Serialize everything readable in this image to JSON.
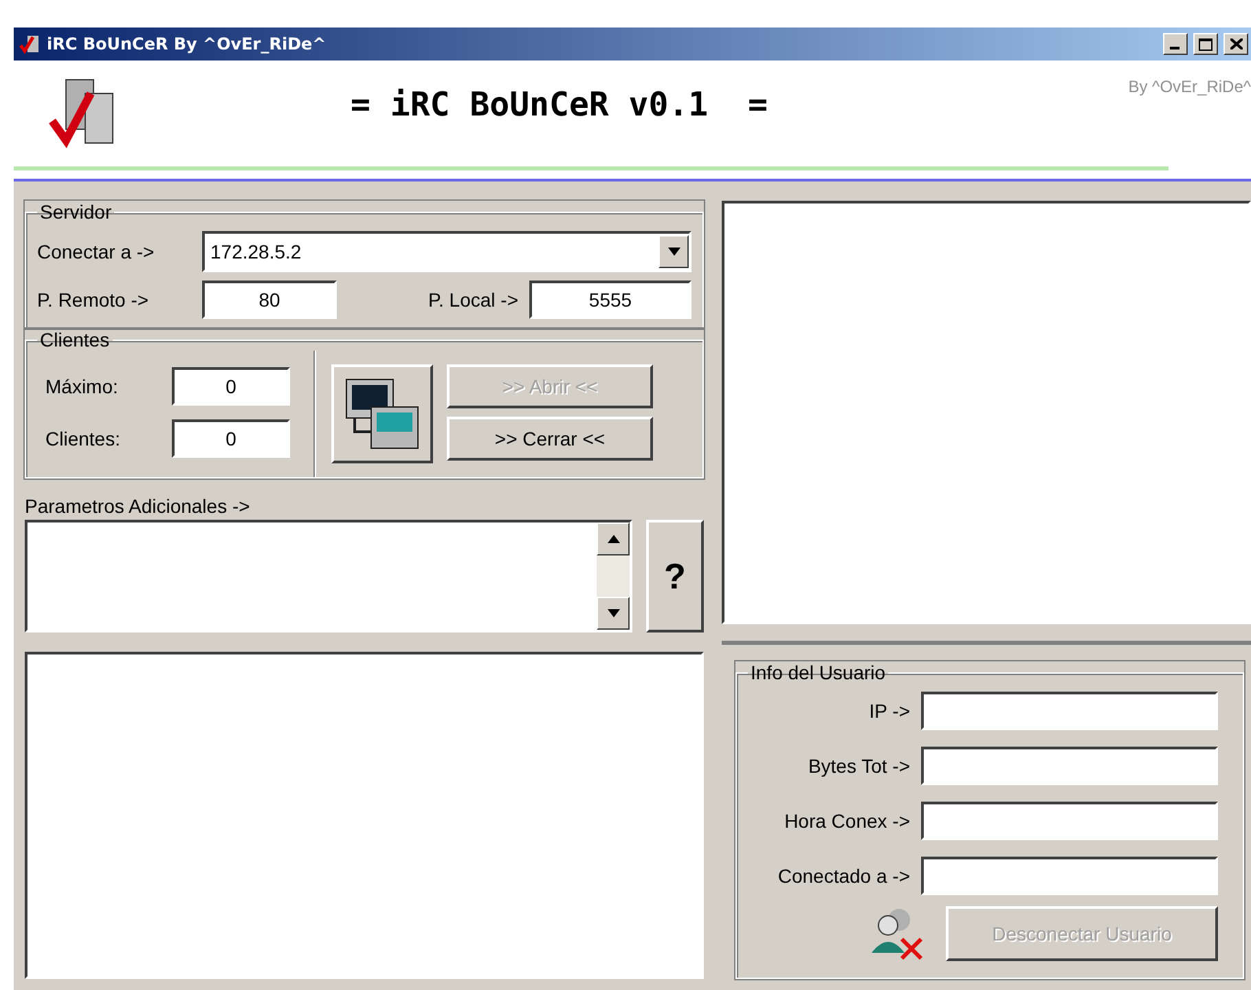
{
  "window": {
    "title": "iRC BoUnCeR By ^OvEr_RiDe^"
  },
  "header": {
    "title": "= iRC BoUnCeR v0.1  =",
    "credit": "By ^OvEr_RiDe^"
  },
  "servidor": {
    "legend": "Servidor",
    "connect_label": "Conectar a ->",
    "connect_value": "172.28.5.2",
    "remote_label": "P. Remoto ->",
    "remote_value": "80",
    "local_label": "P. Local ->",
    "local_value": "5555"
  },
  "clientes": {
    "legend": "Clientes",
    "max_label": "Máximo:",
    "max_value": "0",
    "clients_label": "Clientes:",
    "clients_value": "0"
  },
  "buttons": [
    {
      "label": ">> Abrir <<",
      "disabled": true
    },
    {
      "label": ">> Cerrar <<",
      "disabled": false
    }
  ],
  "params": {
    "label": "Parametros Adicionales ->",
    "help": "?"
  },
  "user_info": {
    "legend": "Info del Usuario",
    "fields": [
      {
        "label": "IP ->"
      },
      {
        "label": "Bytes Tot ->"
      },
      {
        "label": "Hora Conex ->"
      },
      {
        "label": "Conectado a ->"
      }
    ],
    "disconnect": {
      "label": "Desconectar Usuario",
      "disabled": true
    }
  }
}
